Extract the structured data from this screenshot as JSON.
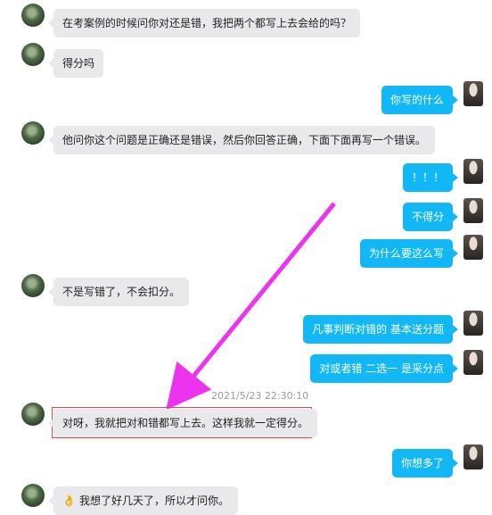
{
  "messages": [
    {
      "side": "in",
      "text": "在考案例的时候问你对还是错，我把两个都写上去会给的吗？"
    },
    {
      "side": "in",
      "text": "得分吗"
    },
    {
      "side": "out",
      "text": "你写的什么"
    },
    {
      "side": "in",
      "text": "他问你这个问题是正确还是错误，然后你回答正确，下面下面再写一个错误。"
    },
    {
      "side": "out",
      "text": "！！！"
    },
    {
      "side": "out",
      "text": "不得分"
    },
    {
      "side": "out",
      "text": "为什么要这么写"
    },
    {
      "side": "in",
      "text": "不是写错了，不会扣分。"
    },
    {
      "side": "out",
      "text": "凡事判断对错的 基本送分题"
    },
    {
      "side": "out",
      "text": "对或者错 二选一 是采分点"
    },
    {
      "side": "in",
      "text": "对呀，我就把对和错都写上去。这样我就一定得分。"
    },
    {
      "side": "out",
      "text": "你想多了"
    },
    {
      "side": "in",
      "text": "我想了好几天了，所以才问你。",
      "prefix_icon": "emoji-icon"
    }
  ],
  "timestamp": "2021/5/23 22:30:10",
  "colors": {
    "incoming_bubble": "#e9e9eb",
    "outgoing_bubble": "#12b7f5",
    "annotation_arrow": "#ee33ee",
    "highlight_box": "#e04a4a"
  }
}
